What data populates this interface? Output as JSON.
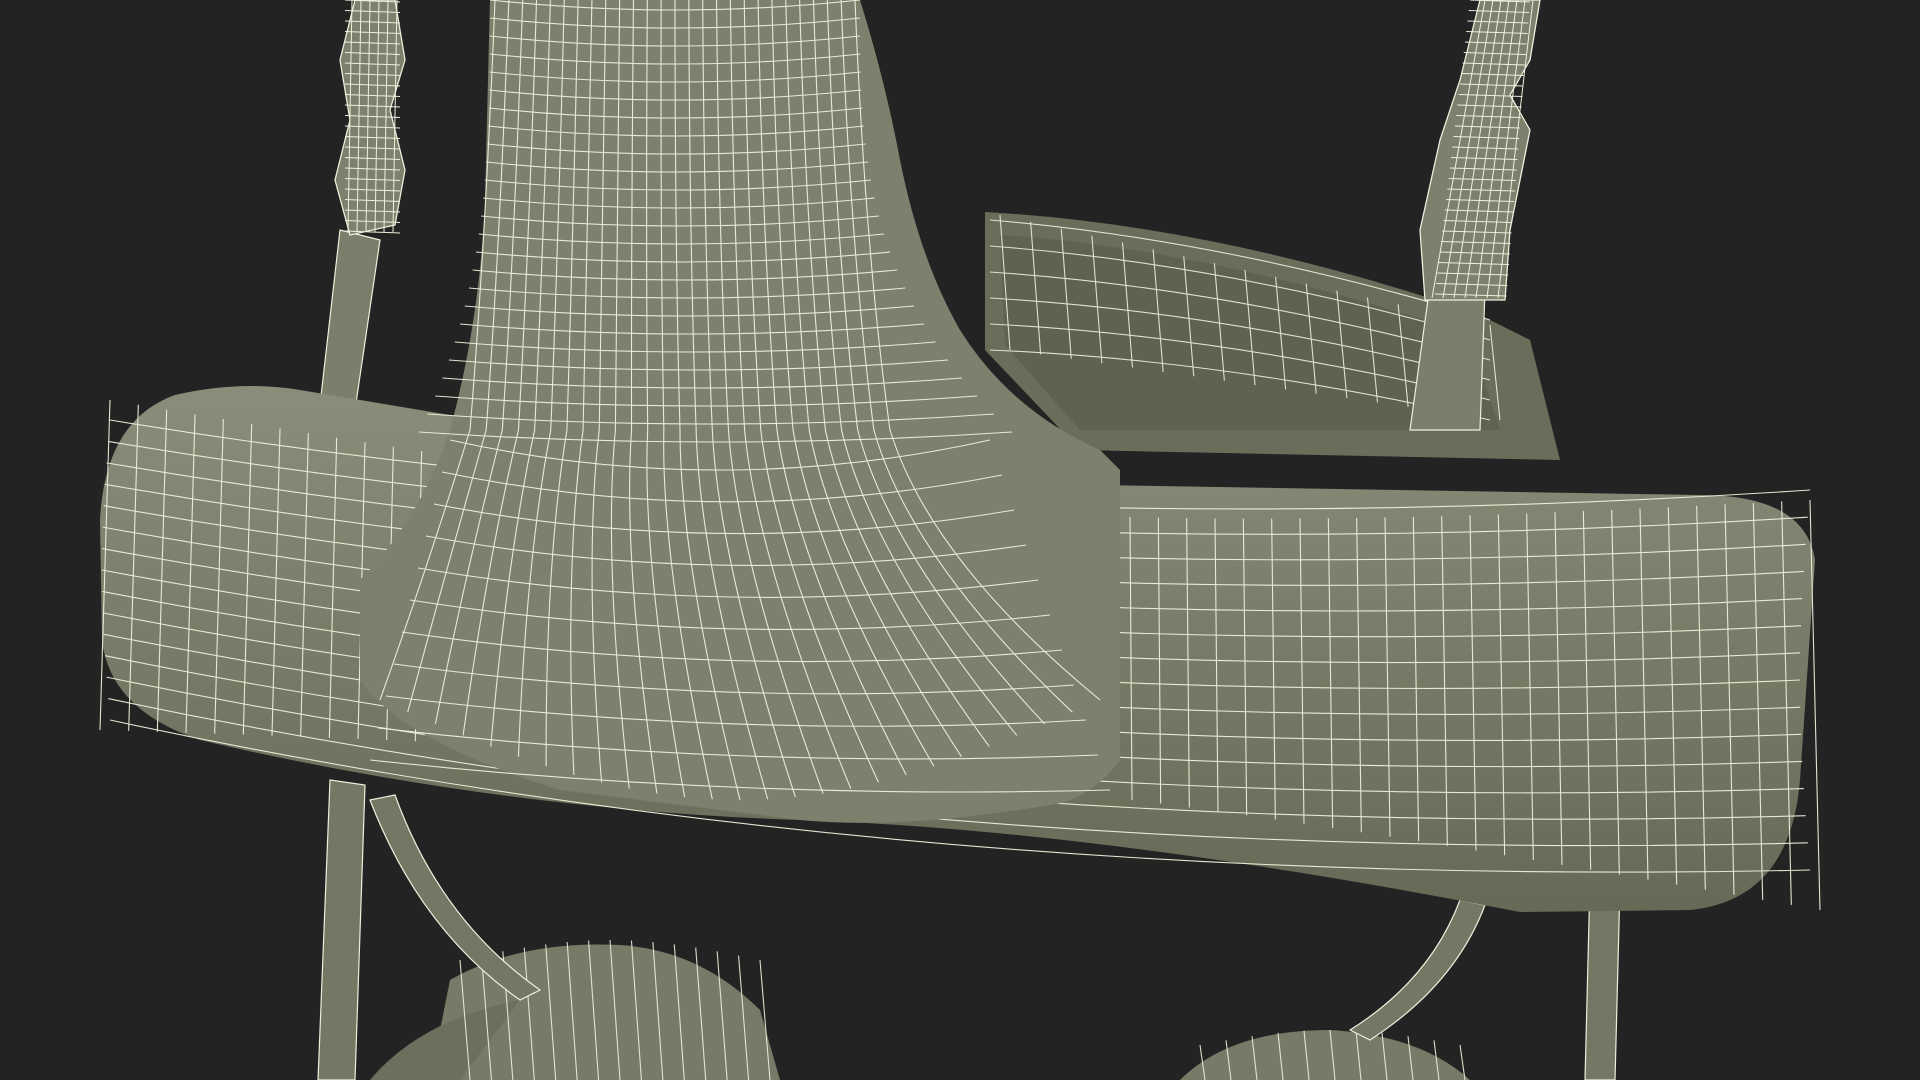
{
  "scene": {
    "background_color": "#232323",
    "surface_color": "#7b7e6b",
    "surface_shade_color": "#666955",
    "wire_color": "#f0eedc"
  }
}
